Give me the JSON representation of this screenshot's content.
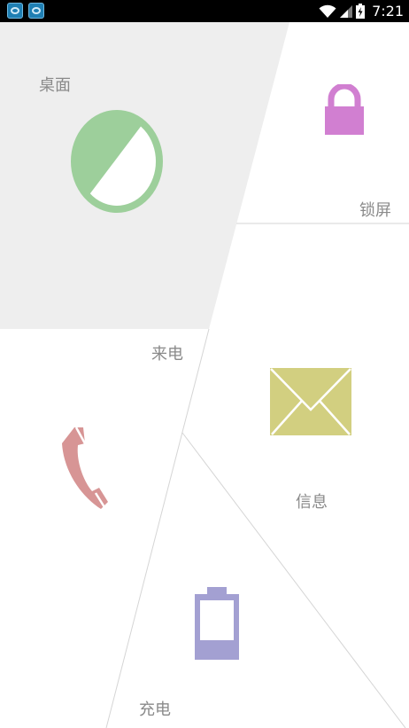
{
  "status_bar": {
    "time": "7:21",
    "notification_icons": [
      "app-notification-icon",
      "app-notification-icon"
    ],
    "indicators": [
      "wifi-icon",
      "signal-icon",
      "battery-charging-icon"
    ]
  },
  "panels": {
    "desktop": {
      "label": "桌面",
      "icon": "theme-icon",
      "color": "#9dcf9b",
      "background": "#eeeeee"
    },
    "lock_screen": {
      "label": "锁屏",
      "icon": "lock-icon",
      "color": "#d17fd1"
    },
    "incoming_call": {
      "label": "来电",
      "icon": "phone-icon",
      "color": "#d79595"
    },
    "message": {
      "label": "信息",
      "icon": "envelope-icon",
      "color": "#d2cf80"
    },
    "charging": {
      "label": "充电",
      "icon": "battery-icon",
      "color": "#a3a0d2"
    }
  }
}
